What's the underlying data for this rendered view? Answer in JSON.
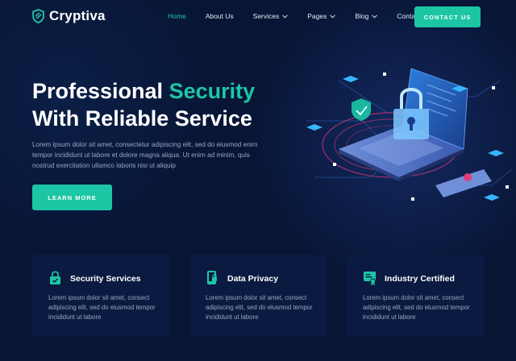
{
  "brand": {
    "name": "Cryptiva",
    "accent": "#1cc6a5",
    "background": "#081535"
  },
  "nav": {
    "items": [
      {
        "label": "Home",
        "active": true,
        "dropdown": false
      },
      {
        "label": "About Us",
        "active": false,
        "dropdown": false
      },
      {
        "label": "Services",
        "active": false,
        "dropdown": true
      },
      {
        "label": "Pages",
        "active": false,
        "dropdown": true
      },
      {
        "label": "Blog",
        "active": false,
        "dropdown": true
      },
      {
        "label": "Contact",
        "active": false,
        "dropdown": false
      }
    ],
    "cta_label": "CONTACT US"
  },
  "hero": {
    "title_line1_prefix": "Professional ",
    "title_line1_accent": "Security",
    "title_line2": "With Reliable Service",
    "text": "Lorem ipsum dolor sit amet, consectetur adipiscing elit, sed do eiusmod enim tempor incididunt ut labore et dolore magna aliqua. Ut enim ad minim, quis nostrud exercitation ullamco laboris nisi ut aliquip",
    "button_label": "LEARN MORE",
    "illustration_icon": "laptop-lock-icon"
  },
  "features": [
    {
      "title": "Security Services",
      "icon": "lock-shield-icon",
      "text": "Lorem ipsum dolor sit amet, consect adipiscing elit, sed do eiusmod tempor incididunt ut labore"
    },
    {
      "title": "Data Privacy",
      "icon": "phone-lock-icon",
      "text": "Lorem ipsum dolor sit amet, consect adipiscing elit, sed do eiusmod tempor incididunt ut labore"
    },
    {
      "title": "Industry Certified",
      "icon": "certificate-icon",
      "text": "Lorem ipsum dolor sit amet, consect adipiscing elit, sed do eiusmod tempor incididunt ut labore"
    }
  ]
}
